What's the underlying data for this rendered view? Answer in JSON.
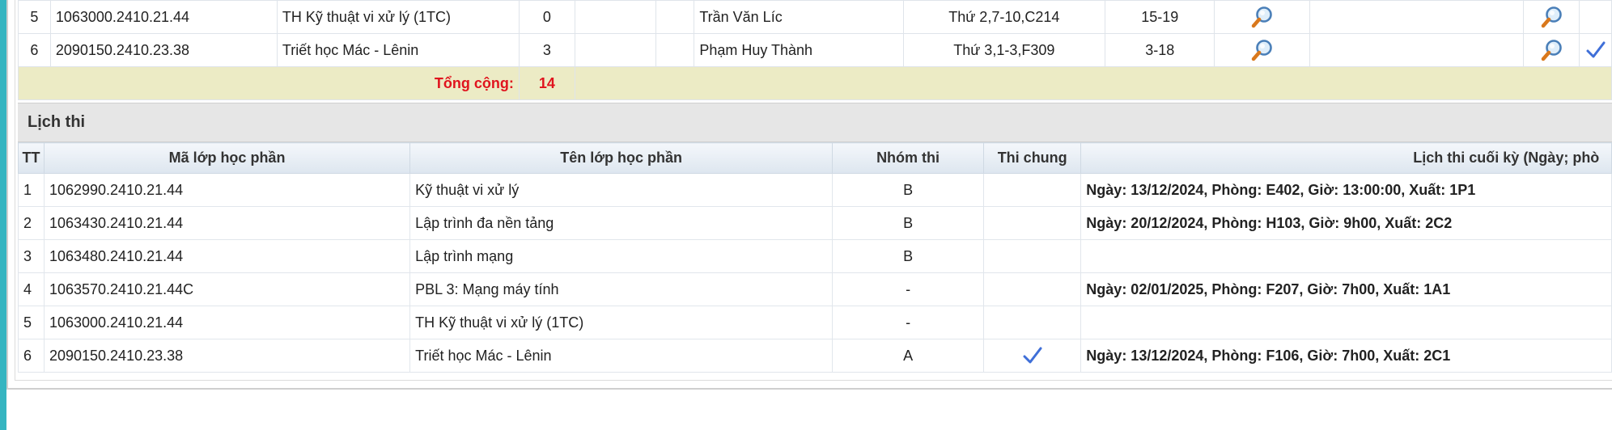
{
  "registration": {
    "rows": [
      {
        "tt": "5",
        "code": "1063000.2410.21.44",
        "name": "TH Kỹ thuật vi xử lý (1TC)",
        "credits": "0",
        "lecturer": "Trần Văn Líc",
        "schedule": "Thứ 2,7-10,C214",
        "weeks": "15-19",
        "checked": false
      },
      {
        "tt": "6",
        "code": "2090150.2410.23.38",
        "name": "Triết học Mác - Lênin",
        "credits": "3",
        "lecturer": "Phạm Huy Thành",
        "schedule": "Thứ 3,1-3,F309",
        "weeks": "3-18",
        "checked": true
      }
    ],
    "total_label": "Tổng cộng:",
    "total_value": "14",
    "icons": {
      "detail": "magnifier-icon",
      "selected": "checkmark-icon"
    }
  },
  "exam_schedule": {
    "title": "Lịch thi",
    "headers": [
      "TT",
      "Mã lớp học phần",
      "Tên lớp học phần",
      "Nhóm thi",
      "Thi chung",
      "Lịch thi cuối kỳ (Ngày; phò"
    ],
    "rows": [
      {
        "tt": "1",
        "code": "1062990.2410.21.44",
        "name": "Kỹ thuật vi xử lý",
        "group": "B",
        "common": false,
        "schedule": "Ngày: 13/12/2024, Phòng: E402, Giờ: 13:00:00, Xuất: 1P1"
      },
      {
        "tt": "2",
        "code": "1063430.2410.21.44",
        "name": "Lập trình đa nền tảng",
        "group": "B",
        "common": false,
        "schedule": "Ngày: 20/12/2024, Phòng: H103, Giờ: 9h00, Xuất: 2C2"
      },
      {
        "tt": "3",
        "code": "1063480.2410.21.44",
        "name": "Lập trình mạng",
        "group": "B",
        "common": false,
        "schedule": ""
      },
      {
        "tt": "4",
        "code": "1063570.2410.21.44C",
        "name": "PBL 3: Mạng máy tính",
        "group": "-",
        "common": false,
        "schedule": "Ngày: 02/01/2025, Phòng: F207, Giờ: 7h00, Xuất: 1A1"
      },
      {
        "tt": "5",
        "code": "1063000.2410.21.44",
        "name": "TH Kỹ thuật vi xử lý (1TC)",
        "group": "-",
        "common": false,
        "schedule": ""
      },
      {
        "tt": "6",
        "code": "2090150.2410.23.38",
        "name": "Triết học Mác - Lênin",
        "group": "A",
        "common": true,
        "schedule": "Ngày: 13/12/2024, Phòng: F106, Giờ: 7h00, Xuất: 2C1"
      }
    ]
  },
  "colors": {
    "accent": "#35b5c1",
    "total_text": "#e0141e",
    "total_bg": "#ecebc5",
    "check": "#3f6fd8"
  }
}
